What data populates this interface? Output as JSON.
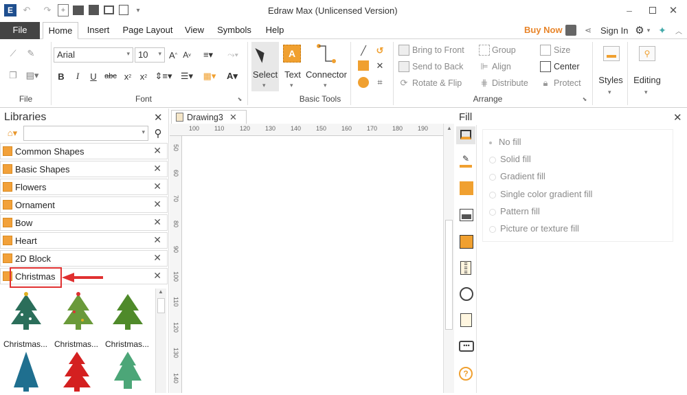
{
  "window": {
    "title": "Edraw Max (Unlicensed Version)"
  },
  "menu": {
    "file": "File",
    "tabs": [
      "Home",
      "Insert",
      "Page Layout",
      "View",
      "Symbols",
      "Help"
    ],
    "buy_now": "Buy Now",
    "sign_in": "Sign In"
  },
  "ribbon": {
    "font_name": "Arial",
    "font_size": "10",
    "groups": {
      "file": "File",
      "font": "Font",
      "basic_tools": "Basic Tools",
      "arrange": "Arrange"
    },
    "tools": {
      "select": "Select",
      "text": "Text",
      "connector": "Connector"
    },
    "arrange": {
      "bring_to_front": "Bring to Front",
      "send_to_back": "Send to Back",
      "rotate_flip": "Rotate & Flip",
      "group": "Group",
      "align": "Align",
      "distribute": "Distribute",
      "size": "Size",
      "center": "Center",
      "protect": "Protect"
    },
    "styles": "Styles",
    "editing": "Editing"
  },
  "libraries": {
    "title": "Libraries",
    "items": [
      "Common Shapes",
      "Basic Shapes",
      "Flowers",
      "Ornament",
      "Bow",
      "Heart",
      "2D Block",
      "Christmas"
    ],
    "thumbnails": [
      "Christmas...",
      "Christmas...",
      "Christmas..."
    ]
  },
  "document": {
    "tab": "Drawing3",
    "ruler_top": [
      "100",
      "110",
      "120",
      "130",
      "140",
      "150",
      "160",
      "170",
      "180",
      "190"
    ],
    "ruler_left": [
      "50",
      "60",
      "70",
      "80",
      "90",
      "100",
      "110",
      "120",
      "130",
      "140"
    ]
  },
  "fill": {
    "title": "Fill",
    "options": [
      "No fill",
      "Solid fill",
      "Gradient fill",
      "Single color gradient fill",
      "Pattern fill",
      "Picture or texture fill"
    ]
  },
  "colors": {
    "accent_orange": "#f0a030",
    "annotation_red": "#e03030",
    "file_tab": "#444444"
  }
}
